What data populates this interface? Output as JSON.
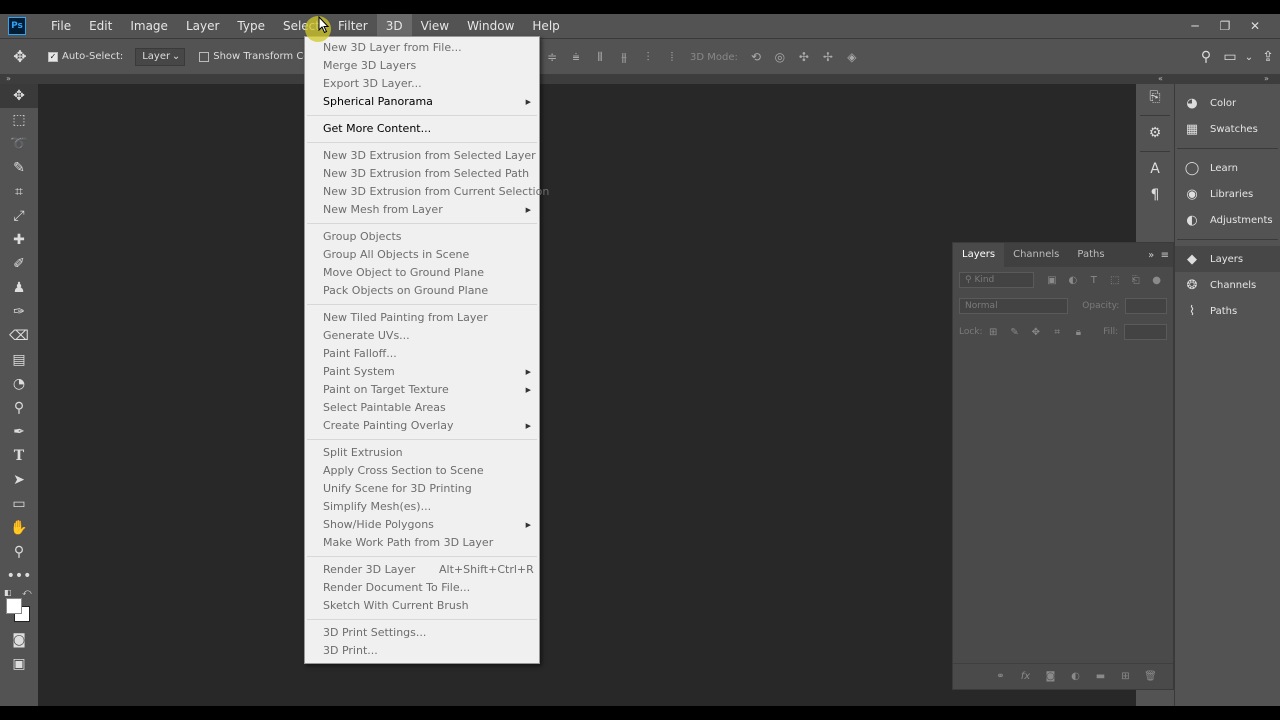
{
  "app": {
    "logo": "Ps"
  },
  "menubar": {
    "items": [
      "File",
      "Edit",
      "Image",
      "Layer",
      "Type",
      "Select",
      "Filter",
      "3D",
      "View",
      "Window",
      "Help"
    ],
    "window_controls": [
      "─",
      "❐",
      "✕"
    ]
  },
  "options": {
    "auto_select_label": "Auto-Select:",
    "auto_select_target": "Layer",
    "show_transform_label": "Show Transform Co",
    "mode_label": "3D Mode:"
  },
  "menu_3d": {
    "items": [
      {
        "label": "New 3D Layer from File...",
        "enabled": false
      },
      {
        "label": "Merge 3D Layers",
        "enabled": false
      },
      {
        "label": "Export 3D Layer...",
        "enabled": false
      },
      {
        "label": "Spherical Panorama",
        "enabled": true,
        "submenu": true
      },
      {
        "separator": true
      },
      {
        "label": "Get More Content...",
        "enabled": true
      },
      {
        "separator": true
      },
      {
        "label": "New 3D Extrusion from Selected Layer",
        "enabled": false
      },
      {
        "label": "New 3D Extrusion from Selected Path",
        "enabled": false
      },
      {
        "label": "New 3D Extrusion from Current Selection",
        "enabled": false
      },
      {
        "label": "New Mesh from Layer",
        "enabled": false,
        "submenu": true
      },
      {
        "separator": true
      },
      {
        "label": "Group Objects",
        "enabled": false
      },
      {
        "label": "Group All Objects in Scene",
        "enabled": false
      },
      {
        "label": "Move Object to Ground Plane",
        "enabled": false
      },
      {
        "label": "Pack Objects on Ground Plane",
        "enabled": false
      },
      {
        "separator": true
      },
      {
        "label": "New Tiled Painting from Layer",
        "enabled": false
      },
      {
        "label": "Generate UVs...",
        "enabled": false
      },
      {
        "label": "Paint Falloff...",
        "enabled": false
      },
      {
        "label": "Paint System",
        "enabled": false,
        "submenu": true
      },
      {
        "label": "Paint on Target Texture",
        "enabled": false,
        "submenu": true
      },
      {
        "label": "Select Paintable Areas",
        "enabled": false
      },
      {
        "label": "Create Painting Overlay",
        "enabled": false,
        "submenu": true
      },
      {
        "separator": true
      },
      {
        "label": "Split Extrusion",
        "enabled": false
      },
      {
        "label": "Apply Cross Section to Scene",
        "enabled": false
      },
      {
        "label": "Unify Scene for 3D Printing",
        "enabled": false
      },
      {
        "label": "Simplify Mesh(es)...",
        "enabled": false
      },
      {
        "label": "Show/Hide Polygons",
        "enabled": false,
        "submenu": true
      },
      {
        "label": "Make Work Path from 3D Layer",
        "enabled": false
      },
      {
        "separator": true
      },
      {
        "label": "Render 3D Layer",
        "enabled": false,
        "shortcut": "Alt+Shift+Ctrl+R"
      },
      {
        "label": "Render Document To File...",
        "enabled": false
      },
      {
        "label": "Sketch With Current Brush",
        "enabled": false
      },
      {
        "separator": true
      },
      {
        "label": "3D Print Settings...",
        "enabled": false
      },
      {
        "label": "3D Print...",
        "enabled": false
      }
    ]
  },
  "dock": {
    "items": [
      {
        "label": "Color",
        "icon": "color-wheel-icon",
        "glyph": "◕"
      },
      {
        "label": "Swatches",
        "icon": "swatches-grid-icon",
        "glyph": "▦"
      },
      {
        "label": "Learn",
        "icon": "lightbulb-icon",
        "glyph": "◯"
      },
      {
        "label": "Libraries",
        "icon": "libraries-icon",
        "glyph": "◉"
      },
      {
        "label": "Adjustments",
        "icon": "adjustments-icon",
        "glyph": "◐"
      },
      {
        "label": "Layers",
        "icon": "layers-stack-icon",
        "glyph": "◆"
      },
      {
        "label": "Channels",
        "icon": "channels-icon",
        "glyph": "❂"
      },
      {
        "label": "Paths",
        "icon": "paths-icon",
        "glyph": "⌇"
      }
    ]
  },
  "layers_panel": {
    "tabs": [
      "Layers",
      "Channels",
      "Paths"
    ],
    "kind_placeholder": "Kind",
    "blend_mode": "Normal",
    "opacity_label": "Opacity:",
    "lock_label": "Lock:",
    "fill_label": "Fill:"
  },
  "colors": {
    "accent": "#2fa3f6",
    "menu_bg": "#f0f0f0",
    "panel_bg": "#535353"
  }
}
